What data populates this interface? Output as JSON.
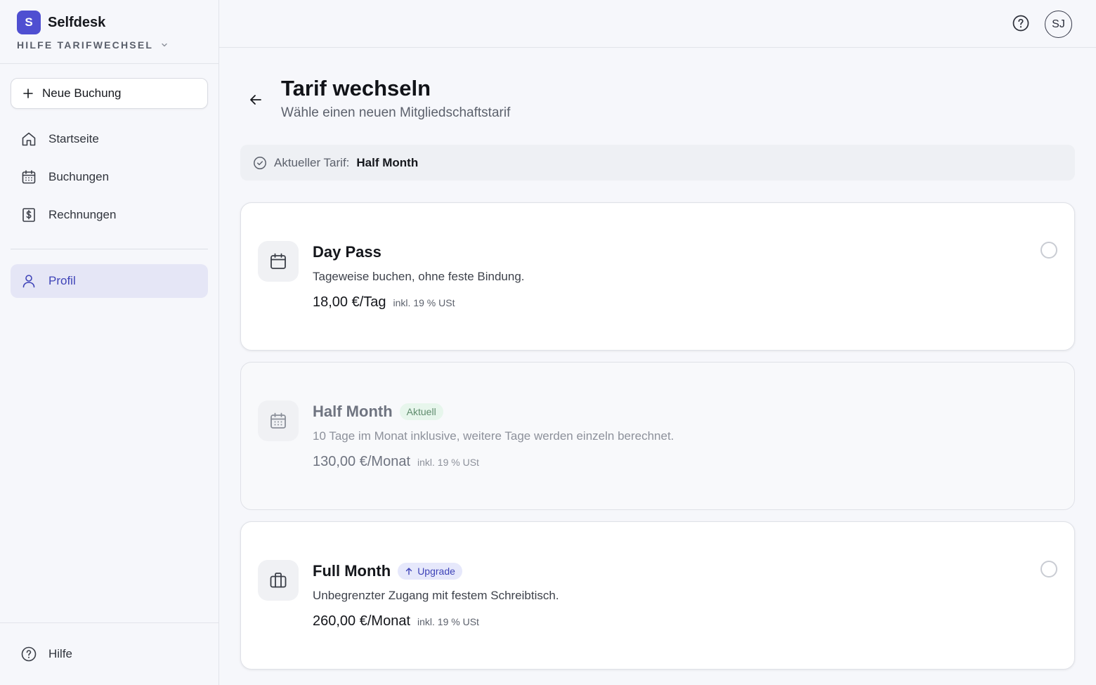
{
  "brand": {
    "logo_letter": "S",
    "name": "Selfdesk",
    "workspace": "HILFE TARIFWECHSEL"
  },
  "sidebar": {
    "new_booking_label": "Neue Buchung",
    "items": [
      {
        "label": "Startseite",
        "icon": "home-icon"
      },
      {
        "label": "Buchungen",
        "icon": "calendar-icon"
      },
      {
        "label": "Rechnungen",
        "icon": "invoice-icon"
      },
      {
        "label": "Profil",
        "icon": "user-icon",
        "active": true
      }
    ],
    "help_label": "Hilfe"
  },
  "topbar": {
    "avatar_initials": "SJ",
    "help_icon": "help-circle-icon"
  },
  "page": {
    "title": "Tarif wechseln",
    "subtitle": "Wähle einen neuen Mitgliedschaftstarif",
    "current_plan_label": "Aktueller Tarif:",
    "current_plan_value": "Half Month"
  },
  "plans": [
    {
      "name": "Day Pass",
      "description": "Tageweise buchen, ohne feste Bindung.",
      "price": "18,00 €/Tag",
      "tax_note": "inkl. 19 % USt",
      "icon": "calendar-icon",
      "selectable": true
    },
    {
      "name": "Half Month",
      "badge": "Aktuell",
      "description": "10 Tage im Monat inklusive, weitere Tage werden einzeln berechnet.",
      "price": "130,00 €/Monat",
      "tax_note": "inkl. 19 % USt",
      "icon": "calendar-days-icon",
      "selectable": false
    },
    {
      "name": "Full Month",
      "badge": "Upgrade",
      "description": "Unbegrenzter Zugang mit festem Schreibtisch.",
      "price": "260,00 €/Monat",
      "tax_note": "inkl. 19 % USt",
      "icon": "briefcase-icon",
      "selectable": true
    }
  ],
  "colors": {
    "accent": "#4f4fd1",
    "active_nav_bg": "#e5e6f6",
    "active_nav_text": "#3f44b8",
    "badge_current_bg": "#e7f6ec",
    "badge_upgrade_bg": "#e6e8fb"
  }
}
